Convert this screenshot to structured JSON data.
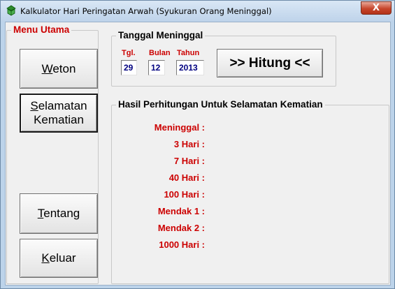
{
  "window": {
    "title": "Kalkulator Hari Peringatan Arwah (Syukuran Orang Meninggal)",
    "close_label": "X"
  },
  "menu": {
    "legend": "Menu Utama",
    "buttons": [
      {
        "key": "W",
        "rest": "eton"
      },
      {
        "key": "S",
        "rest": "elamatan",
        "line2": "Kematian"
      },
      {
        "key": "T",
        "rest": "entang"
      },
      {
        "key": "K",
        "rest": "eluar"
      }
    ]
  },
  "date": {
    "legend": "Tanggal Meninggal",
    "labels": {
      "day": "Tgl.",
      "month": "Bulan",
      "year": "Tahun"
    },
    "values": {
      "day": "29",
      "month": "12",
      "year": "2013"
    },
    "calc_button": ">> Hitung <<"
  },
  "results": {
    "legend": "Hasil Perhitungan Untuk Selamatan Kematian",
    "rows": [
      "Meninggal :",
      "3 Hari :",
      "7 Hari :",
      "40 Hari :",
      "100 Hari :",
      "Mendak 1 :",
      "Mendak 2 :",
      "1000 Hari :"
    ]
  },
  "colors": {
    "label_red": "#cc0000",
    "field_text": "#000080",
    "client_bg": "#f0f0f0"
  }
}
